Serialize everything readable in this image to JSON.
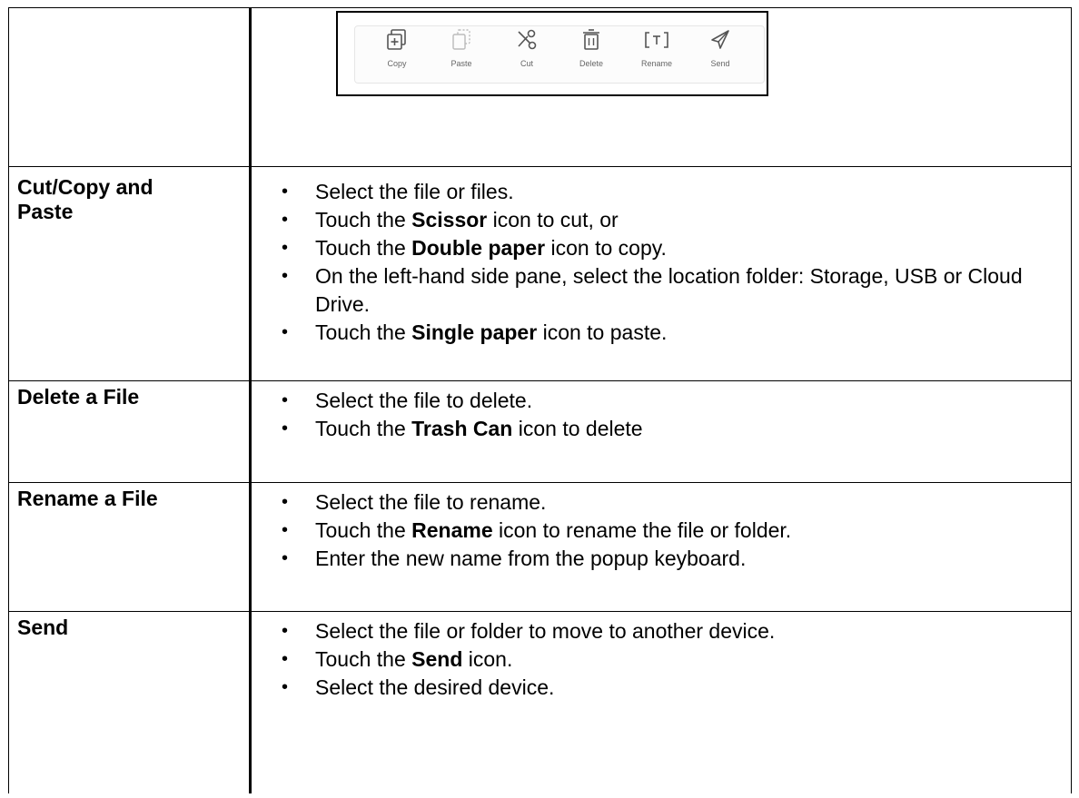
{
  "toolbar": {
    "items": [
      {
        "label": "Copy",
        "icon": "copy-icon"
      },
      {
        "label": "Paste",
        "icon": "paste-icon"
      },
      {
        "label": "Cut",
        "icon": "scissors-icon"
      },
      {
        "label": "Delete",
        "icon": "trash-icon"
      },
      {
        "label": "Rename",
        "icon": "rename-icon"
      },
      {
        "label": "Send",
        "icon": "send-icon"
      }
    ],
    "icon_color": "#555555"
  },
  "rows": [
    {
      "label_line1": "Cut/Copy and",
      "label_line2": "Paste",
      "steps": [
        {
          "pre": "Select the file or files.",
          "bold": "",
          "post": ""
        },
        {
          "pre": "Touch the ",
          "bold": "Scissor",
          "post": " icon to cut, or"
        },
        {
          "pre": "Touch the ",
          "bold": "Double paper",
          "post": " icon to copy."
        },
        {
          "pre": "On the left-hand side pane, select the location folder: Storage, USB or Cloud Drive.",
          "bold": "",
          "post": ""
        },
        {
          "pre": "Touch the ",
          "bold": "Single paper",
          "post": " icon to paste."
        }
      ]
    },
    {
      "label_line1": "Delete a File",
      "steps": [
        {
          "pre": "Select the file to delete.",
          "bold": "",
          "post": ""
        },
        {
          "pre": "Touch the ",
          "bold": "Trash Can",
          "post": " icon to delete"
        }
      ]
    },
    {
      "label_line1": "Rename a File",
      "steps": [
        {
          "pre": "Select the file to rename.",
          "bold": "",
          "post": ""
        },
        {
          "pre": "Touch the ",
          "bold": "Rename",
          "post": " icon to rename the file or folder."
        },
        {
          "pre": "Enter the new name from the popup keyboard.",
          "bold": "",
          "post": ""
        }
      ]
    },
    {
      "label_line1": "Send",
      "steps": [
        {
          "pre": "Select the file or folder to move to another device.",
          "bold": "",
          "post": ""
        },
        {
          "pre": "Touch the ",
          "bold": "Send",
          "post": " icon."
        },
        {
          "pre": "Select the desired device.",
          "bold": "",
          "post": ""
        }
      ]
    }
  ]
}
